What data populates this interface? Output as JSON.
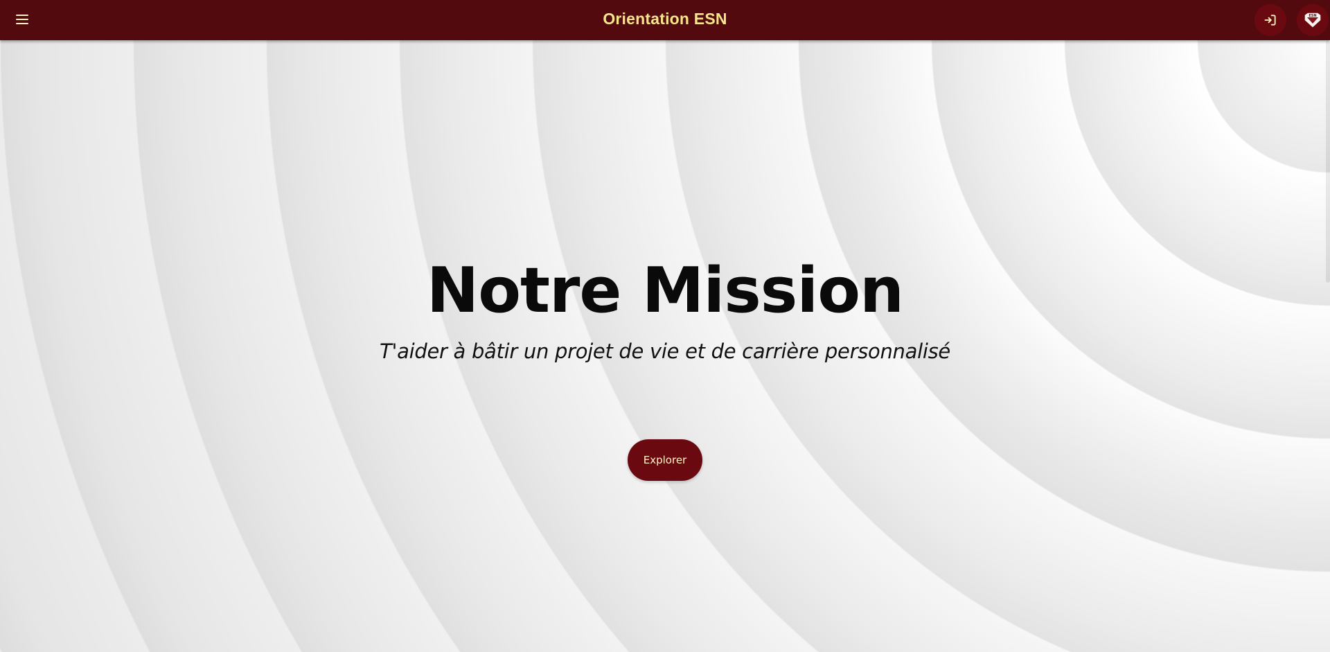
{
  "header": {
    "title": "Orientation ESN",
    "menu_icon": "hamburger-menu-icon",
    "login_icon": "login-icon",
    "logo_icon": "esn-logo-icon",
    "logo_text": "ESN"
  },
  "hero": {
    "title": "Notre Mission",
    "subtitle": "T'aider à bâtir un projet de vie et de carrière personnalisé",
    "button_label": "Explorer"
  },
  "colors": {
    "header_background": "#520a0e",
    "accent": "#6a0a10",
    "title_text": "#f7e58c",
    "button_text": "#fff3c4",
    "page_background": "#ececec"
  }
}
